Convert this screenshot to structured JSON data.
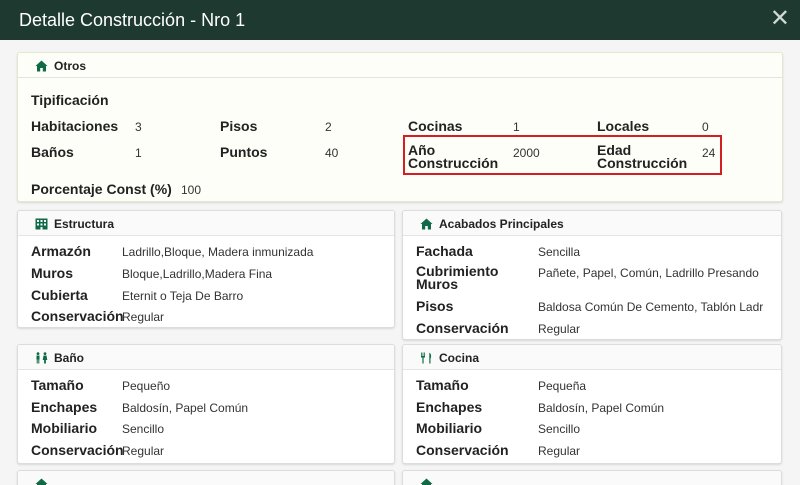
{
  "modal": {
    "title": "Detalle Construcción - Nro 1",
    "close_glyph": "✕"
  },
  "colors": {
    "header": "#1e3a30",
    "accent": "#0f6b45",
    "highlight": "#d41e24"
  },
  "otros": {
    "title": "Otros",
    "icon": "home-icon",
    "tipificacion_label": "Tipificación",
    "habitaciones": {
      "label": "Habitaciones",
      "value": "3"
    },
    "pisos": {
      "label": "Pisos",
      "value": "2"
    },
    "cocinas": {
      "label": "Cocinas",
      "value": "1"
    },
    "locales": {
      "label": "Locales",
      "value": "0"
    },
    "banos": {
      "label": "Baños",
      "value": "1"
    },
    "puntos": {
      "label": "Puntos",
      "value": "40"
    },
    "ano_construccion": {
      "label_1": "Año",
      "label_2": "Construcción",
      "value": "2000"
    },
    "edad_construccion": {
      "label_1": "Edad",
      "label_2": "Construcción",
      "value": "24"
    },
    "porcentaje": {
      "label": "Porcentaje Const (%)",
      "value": "100"
    }
  },
  "estructura": {
    "title": "Estructura",
    "icon": "building-icon",
    "rows": [
      {
        "label": "Armazón",
        "value": "Ladrillo,Bloque, Madera inmunizada"
      },
      {
        "label": "Muros",
        "value": "Bloque,Ladrillo,Madera Fina"
      },
      {
        "label": "Cubierta",
        "value": "Eternit o Teja De Barro"
      },
      {
        "label": "Conservación",
        "value": "Regular"
      }
    ]
  },
  "acabados": {
    "title": "Acabados Principales",
    "icon": "home-icon",
    "fachada": {
      "label": "Fachada",
      "value": "Sencilla"
    },
    "cubrimiento": {
      "label_1": "Cubrimiento",
      "label_2": "Muros",
      "value": "Pañete, Papel, Común, Ladrillo Presando"
    },
    "pisos": {
      "label": "Pisos",
      "value": "Baldosa Común De Cemento, Tablón Ladr"
    },
    "conservacion": {
      "label": "Conservación",
      "value": "Regular"
    }
  },
  "bano": {
    "title": "Baño",
    "icon": "restroom-icon",
    "rows": [
      {
        "label": "Tamaño",
        "value": "Pequeño"
      },
      {
        "label": "Enchapes",
        "value": "Baldosín, Papel Común"
      },
      {
        "label": "Mobiliario",
        "value": "Sencillo"
      },
      {
        "label": "Conservación",
        "value": "Regular"
      }
    ]
  },
  "cocina": {
    "title": "Cocina",
    "icon": "utensils-icon",
    "rows": [
      {
        "label": "Tamaño",
        "value": "Pequeña"
      },
      {
        "label": "Enchapes",
        "value": "Baldosín, Papel Común"
      },
      {
        "label": "Mobiliario",
        "value": "Sencillo"
      },
      {
        "label": "Conservación",
        "value": "Regular"
      }
    ]
  }
}
